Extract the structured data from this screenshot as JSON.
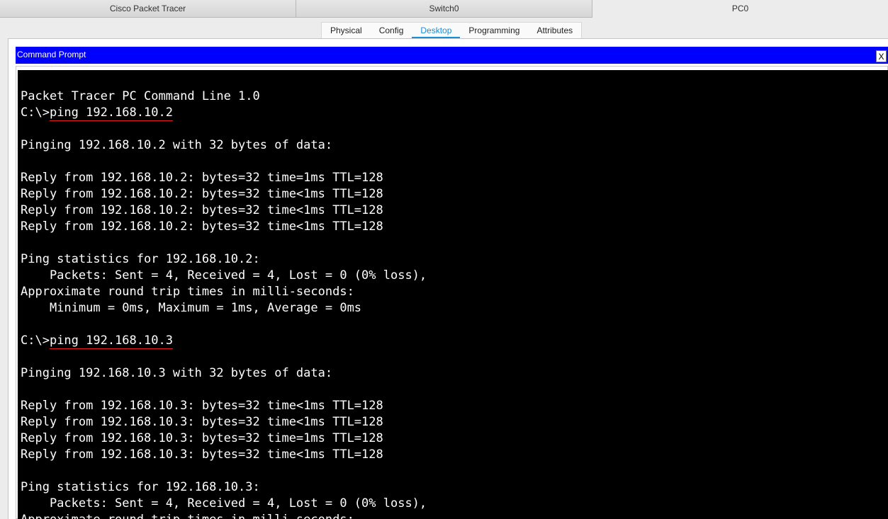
{
  "window_tabs": [
    "Cisco Packet Tracer",
    "Switch0",
    "PC0"
  ],
  "device_tabs": [
    "Physical",
    "Config",
    "Desktop",
    "Programming",
    "Attributes"
  ],
  "active_device_tab": "Desktop",
  "command_prompt": {
    "title": "Command Prompt",
    "close_label": "X"
  },
  "terminal": {
    "lines": [
      "Packet Tracer PC Command Line 1.0",
      {
        "prompt": "C:\\>",
        "command": "ping 192.168.10.2"
      },
      "",
      "Pinging 192.168.10.2 with 32 bytes of data:",
      "",
      "Reply from 192.168.10.2: bytes=32 time=1ms TTL=128",
      "Reply from 192.168.10.2: bytes=32 time<1ms TTL=128",
      "Reply from 192.168.10.2: bytes=32 time<1ms TTL=128",
      "Reply from 192.168.10.2: bytes=32 time<1ms TTL=128",
      "",
      "Ping statistics for 192.168.10.2:",
      "    Packets: Sent = 4, Received = 4, Lost = 0 (0% loss),",
      "Approximate round trip times in milli-seconds:",
      "    Minimum = 0ms, Maximum = 1ms, Average = 0ms",
      "",
      {
        "prompt": "C:\\>",
        "command": "ping 192.168.10.3"
      },
      "",
      "Pinging 192.168.10.3 with 32 bytes of data:",
      "",
      "Reply from 192.168.10.3: bytes=32 time<1ms TTL=128",
      "Reply from 192.168.10.3: bytes=32 time<1ms TTL=128",
      "Reply from 192.168.10.3: bytes=32 time=1ms TTL=128",
      "Reply from 192.168.10.3: bytes=32 time<1ms TTL=128",
      "",
      "Ping statistics for 192.168.10.3:",
      "    Packets: Sent = 4, Received = 4, Lost = 0 (0% loss),",
      "Approximate round trip times in milli-seconds:"
    ]
  },
  "colors": {
    "title_bar": "#0000ff",
    "active_tab": "#1a8fd4",
    "command_underline": "#e21a1a",
    "terminal_bg": "#000000",
    "terminal_fg": "#ffffff"
  }
}
